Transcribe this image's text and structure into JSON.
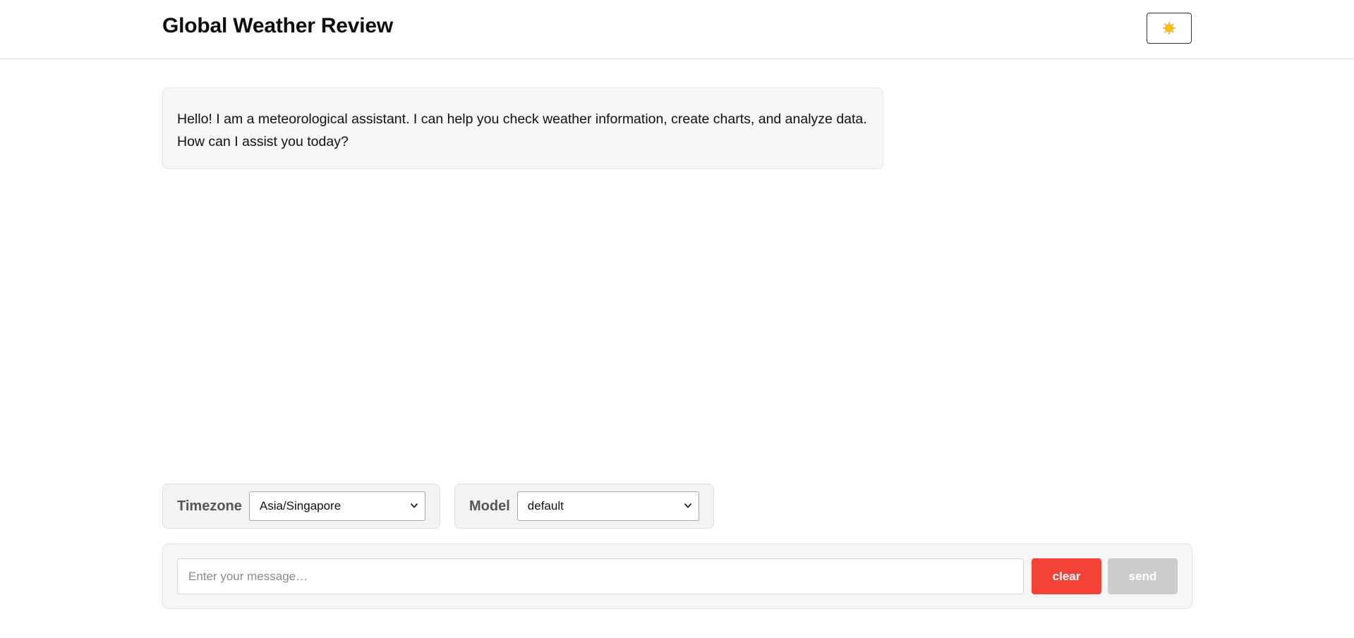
{
  "header": {
    "title": "Global Weather Review",
    "theme_icon": "sun-icon"
  },
  "colors": {
    "accent_red": "#f44336",
    "disabled_gray": "#cccccc",
    "sun_yellow": "#ffc107"
  },
  "chat": {
    "messages": [
      {
        "role": "assistant",
        "text": "Hello! I am a meteorological assistant. I can help you check weather information, create charts, and analyze data. How can I assist you today?"
      }
    ]
  },
  "controls": {
    "timezone": {
      "label": "Timezone",
      "selected": "Asia/Singapore"
    },
    "model": {
      "label": "Model",
      "selected": "default"
    }
  },
  "composer": {
    "placeholder": "Enter your message…",
    "value": "",
    "clear_label": "clear",
    "send_label": "send",
    "send_enabled": false
  }
}
